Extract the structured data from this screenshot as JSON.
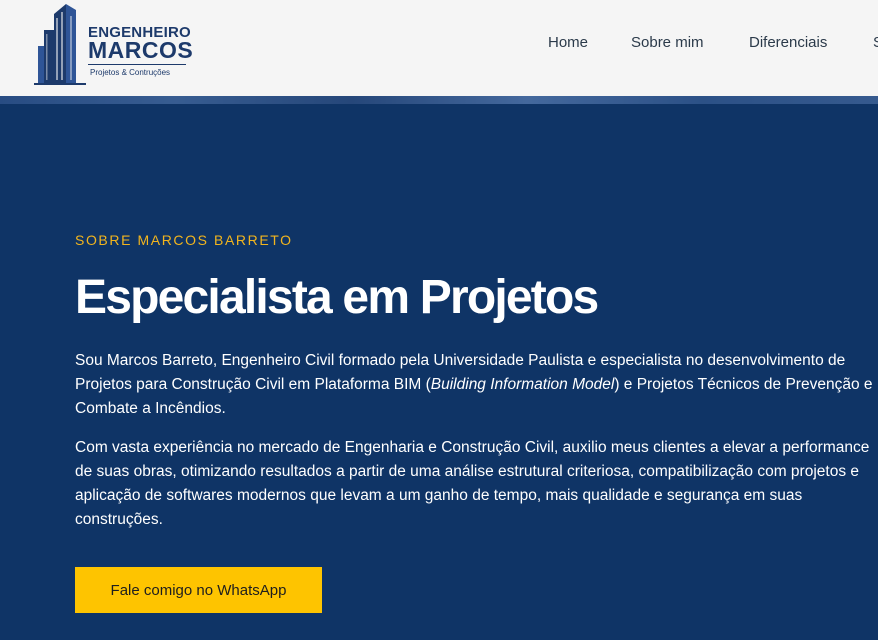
{
  "header": {
    "logo": {
      "line1": "ENGENHEIRO",
      "line2": "MARCOS",
      "line3": "Projetos & Contruções"
    },
    "nav": [
      {
        "label": "Home"
      },
      {
        "label": "Sobre mim"
      },
      {
        "label": "Diferenciais"
      },
      {
        "label": "S"
      }
    ]
  },
  "about": {
    "eyebrow": "SOBRE MARCOS BARRETO",
    "headline": "Especialista em Projetos",
    "paragraph1": {
      "before": "Sou Marcos Barreto, Engenheiro Civil formado pela Universidade Paulista e especialista no desenvolvimento de Projetos para Construção Civil em Plataforma BIM (",
      "italic": "Building Information Model",
      "after": ") e Projetos Técnicos de Prevenção e Combate a Incêndios."
    },
    "paragraph2": "Com vasta experiência no mercado de Engenharia e Construção Civil, auxilio meus clientes a elevar a performance de suas obras, otimizando resultados a partir de uma análise estrutural criteriosa, compatibilização com projetos e aplicação de softwares modernos que levam a um ganho de tempo, mais qualidade e segurança em suas construções.",
    "cta_label": "Fale comigo no WhatsApp"
  },
  "colors": {
    "brand_navy": "#0f3466",
    "accent_yellow": "#fec400",
    "eyebrow_gold": "#f2b51e",
    "logo_blue": "#1d3a6b"
  }
}
